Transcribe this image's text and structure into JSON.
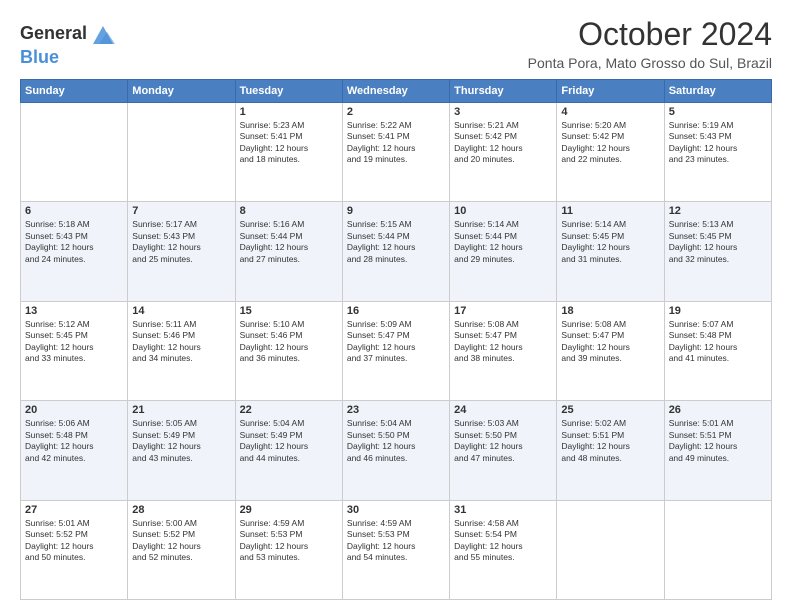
{
  "logo": {
    "line1": "General",
    "line2": "Blue"
  },
  "title": "October 2024",
  "subtitle": "Ponta Pora, Mato Grosso do Sul, Brazil",
  "days_of_week": [
    "Sunday",
    "Monday",
    "Tuesday",
    "Wednesday",
    "Thursday",
    "Friday",
    "Saturday"
  ],
  "weeks": [
    [
      {
        "day": "",
        "sunrise": "",
        "sunset": "",
        "daylight": ""
      },
      {
        "day": "",
        "sunrise": "",
        "sunset": "",
        "daylight": ""
      },
      {
        "day": "1",
        "sunrise": "Sunrise: 5:23 AM",
        "sunset": "Sunset: 5:41 PM",
        "daylight": "Daylight: 12 hours and 18 minutes."
      },
      {
        "day": "2",
        "sunrise": "Sunrise: 5:22 AM",
        "sunset": "Sunset: 5:41 PM",
        "daylight": "Daylight: 12 hours and 19 minutes."
      },
      {
        "day": "3",
        "sunrise": "Sunrise: 5:21 AM",
        "sunset": "Sunset: 5:42 PM",
        "daylight": "Daylight: 12 hours and 20 minutes."
      },
      {
        "day": "4",
        "sunrise": "Sunrise: 5:20 AM",
        "sunset": "Sunset: 5:42 PM",
        "daylight": "Daylight: 12 hours and 22 minutes."
      },
      {
        "day": "5",
        "sunrise": "Sunrise: 5:19 AM",
        "sunset": "Sunset: 5:43 PM",
        "daylight": "Daylight: 12 hours and 23 minutes."
      }
    ],
    [
      {
        "day": "6",
        "sunrise": "Sunrise: 5:18 AM",
        "sunset": "Sunset: 5:43 PM",
        "daylight": "Daylight: 12 hours and 24 minutes."
      },
      {
        "day": "7",
        "sunrise": "Sunrise: 5:17 AM",
        "sunset": "Sunset: 5:43 PM",
        "daylight": "Daylight: 12 hours and 25 minutes."
      },
      {
        "day": "8",
        "sunrise": "Sunrise: 5:16 AM",
        "sunset": "Sunset: 5:44 PM",
        "daylight": "Daylight: 12 hours and 27 minutes."
      },
      {
        "day": "9",
        "sunrise": "Sunrise: 5:15 AM",
        "sunset": "Sunset: 5:44 PM",
        "daylight": "Daylight: 12 hours and 28 minutes."
      },
      {
        "day": "10",
        "sunrise": "Sunrise: 5:14 AM",
        "sunset": "Sunset: 5:44 PM",
        "daylight": "Daylight: 12 hours and 29 minutes."
      },
      {
        "day": "11",
        "sunrise": "Sunrise: 5:14 AM",
        "sunset": "Sunset: 5:45 PM",
        "daylight": "Daylight: 12 hours and 31 minutes."
      },
      {
        "day": "12",
        "sunrise": "Sunrise: 5:13 AM",
        "sunset": "Sunset: 5:45 PM",
        "daylight": "Daylight: 12 hours and 32 minutes."
      }
    ],
    [
      {
        "day": "13",
        "sunrise": "Sunrise: 5:12 AM",
        "sunset": "Sunset: 5:45 PM",
        "daylight": "Daylight: 12 hours and 33 minutes."
      },
      {
        "day": "14",
        "sunrise": "Sunrise: 5:11 AM",
        "sunset": "Sunset: 5:46 PM",
        "daylight": "Daylight: 12 hours and 34 minutes."
      },
      {
        "day": "15",
        "sunrise": "Sunrise: 5:10 AM",
        "sunset": "Sunset: 5:46 PM",
        "daylight": "Daylight: 12 hours and 36 minutes."
      },
      {
        "day": "16",
        "sunrise": "Sunrise: 5:09 AM",
        "sunset": "Sunset: 5:47 PM",
        "daylight": "Daylight: 12 hours and 37 minutes."
      },
      {
        "day": "17",
        "sunrise": "Sunrise: 5:08 AM",
        "sunset": "Sunset: 5:47 PM",
        "daylight": "Daylight: 12 hours and 38 minutes."
      },
      {
        "day": "18",
        "sunrise": "Sunrise: 5:08 AM",
        "sunset": "Sunset: 5:47 PM",
        "daylight": "Daylight: 12 hours and 39 minutes."
      },
      {
        "day": "19",
        "sunrise": "Sunrise: 5:07 AM",
        "sunset": "Sunset: 5:48 PM",
        "daylight": "Daylight: 12 hours and 41 minutes."
      }
    ],
    [
      {
        "day": "20",
        "sunrise": "Sunrise: 5:06 AM",
        "sunset": "Sunset: 5:48 PM",
        "daylight": "Daylight: 12 hours and 42 minutes."
      },
      {
        "day": "21",
        "sunrise": "Sunrise: 5:05 AM",
        "sunset": "Sunset: 5:49 PM",
        "daylight": "Daylight: 12 hours and 43 minutes."
      },
      {
        "day": "22",
        "sunrise": "Sunrise: 5:04 AM",
        "sunset": "Sunset: 5:49 PM",
        "daylight": "Daylight: 12 hours and 44 minutes."
      },
      {
        "day": "23",
        "sunrise": "Sunrise: 5:04 AM",
        "sunset": "Sunset: 5:50 PM",
        "daylight": "Daylight: 12 hours and 46 minutes."
      },
      {
        "day": "24",
        "sunrise": "Sunrise: 5:03 AM",
        "sunset": "Sunset: 5:50 PM",
        "daylight": "Daylight: 12 hours and 47 minutes."
      },
      {
        "day": "25",
        "sunrise": "Sunrise: 5:02 AM",
        "sunset": "Sunset: 5:51 PM",
        "daylight": "Daylight: 12 hours and 48 minutes."
      },
      {
        "day": "26",
        "sunrise": "Sunrise: 5:01 AM",
        "sunset": "Sunset: 5:51 PM",
        "daylight": "Daylight: 12 hours and 49 minutes."
      }
    ],
    [
      {
        "day": "27",
        "sunrise": "Sunrise: 5:01 AM",
        "sunset": "Sunset: 5:52 PM",
        "daylight": "Daylight: 12 hours and 50 minutes."
      },
      {
        "day": "28",
        "sunrise": "Sunrise: 5:00 AM",
        "sunset": "Sunset: 5:52 PM",
        "daylight": "Daylight: 12 hours and 52 minutes."
      },
      {
        "day": "29",
        "sunrise": "Sunrise: 4:59 AM",
        "sunset": "Sunset: 5:53 PM",
        "daylight": "Daylight: 12 hours and 53 minutes."
      },
      {
        "day": "30",
        "sunrise": "Sunrise: 4:59 AM",
        "sunset": "Sunset: 5:53 PM",
        "daylight": "Daylight: 12 hours and 54 minutes."
      },
      {
        "day": "31",
        "sunrise": "Sunrise: 4:58 AM",
        "sunset": "Sunset: 5:54 PM",
        "daylight": "Daylight: 12 hours and 55 minutes."
      },
      {
        "day": "",
        "sunrise": "",
        "sunset": "",
        "daylight": ""
      },
      {
        "day": "",
        "sunrise": "",
        "sunset": "",
        "daylight": ""
      }
    ]
  ]
}
